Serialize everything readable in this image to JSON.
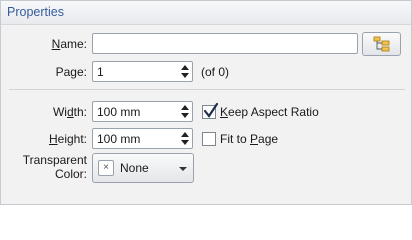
{
  "panel": {
    "title": "Properties"
  },
  "name": {
    "label_prefix": "",
    "label_mnemonic": "N",
    "label_suffix": "ame:",
    "value": ""
  },
  "folder_button": {
    "icon": "folder-tree-icon"
  },
  "page": {
    "label_prefix": "Pa",
    "label_mnemonic": "g",
    "label_suffix": "e:",
    "value": "1",
    "count_text": "(of 0)"
  },
  "width": {
    "label_prefix": "Wi",
    "label_mnemonic": "d",
    "label_suffix": "th:",
    "value": "100 mm"
  },
  "height": {
    "label_prefix": "",
    "label_mnemonic": "H",
    "label_suffix": "eight:",
    "value": "100 mm"
  },
  "keep_aspect": {
    "label_prefix": "",
    "label_mnemonic": "K",
    "label_suffix": "eep Aspect Ratio",
    "checked": true
  },
  "fit_to_page": {
    "label_prefix": "Fit to ",
    "label_mnemonic": "P",
    "label_suffix": "age",
    "checked": false
  },
  "transparent_color": {
    "label_line1": "Transparent",
    "label_line2": "Color:",
    "value": "None",
    "swatch_glyph": "×"
  }
}
